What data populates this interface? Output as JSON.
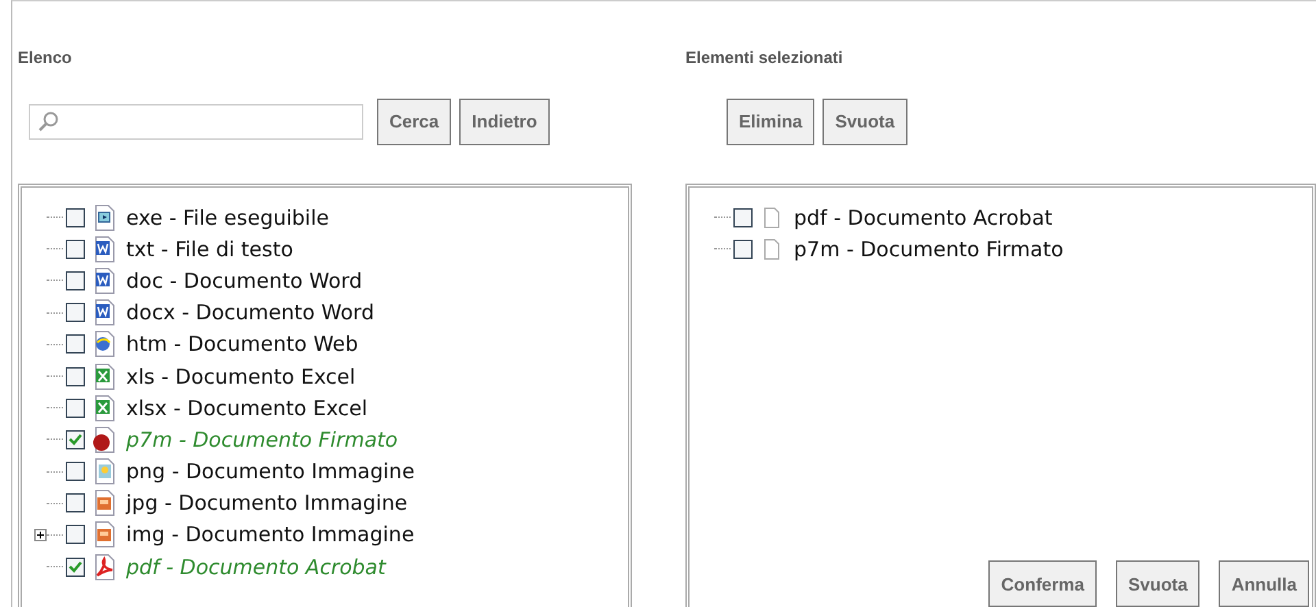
{
  "left": {
    "title": "Elenco",
    "buttons": [
      "Cerca",
      "Indietro"
    ],
    "items": [
      {
        "label": "exe - File eseguibile",
        "checked": false,
        "expandable": false,
        "kind": "exe"
      },
      {
        "label": "txt - File di testo",
        "checked": false,
        "expandable": false,
        "kind": "word"
      },
      {
        "label": "doc - Documento Word",
        "checked": false,
        "expandable": false,
        "kind": "word"
      },
      {
        "label": "docx - Documento Word",
        "checked": false,
        "expandable": false,
        "kind": "word"
      },
      {
        "label": "htm - Documento Web",
        "checked": false,
        "expandable": false,
        "kind": "web"
      },
      {
        "label": "xls - Documento Excel",
        "checked": false,
        "expandable": false,
        "kind": "excel"
      },
      {
        "label": "xlsx - Documento Excel",
        "checked": false,
        "expandable": false,
        "kind": "excel"
      },
      {
        "label": "p7m - Documento Firmato",
        "checked": true,
        "expandable": false,
        "kind": "seal"
      },
      {
        "label": "png - Documento Immagine",
        "checked": false,
        "expandable": false,
        "kind": "image"
      },
      {
        "label": "jpg - Documento Immagine",
        "checked": false,
        "expandable": false,
        "kind": "photo"
      },
      {
        "label": "img - Documento Immagine",
        "checked": false,
        "expandable": true,
        "kind": "photo"
      },
      {
        "label": "pdf - Documento Acrobat",
        "checked": true,
        "expandable": false,
        "kind": "pdf"
      }
    ]
  },
  "right": {
    "title": "Elementi selezionati",
    "buttons": [
      "Elimina",
      "Svuota"
    ],
    "items": [
      {
        "label": "pdf - Documento Acrobat",
        "checked": false,
        "expandable": false,
        "kind": "page"
      },
      {
        "label": "p7m - Documento Firmato",
        "checked": false,
        "expandable": false,
        "kind": "page"
      }
    ],
    "footer_buttons": [
      "Conferma",
      "Svuota",
      "Annulla"
    ]
  }
}
